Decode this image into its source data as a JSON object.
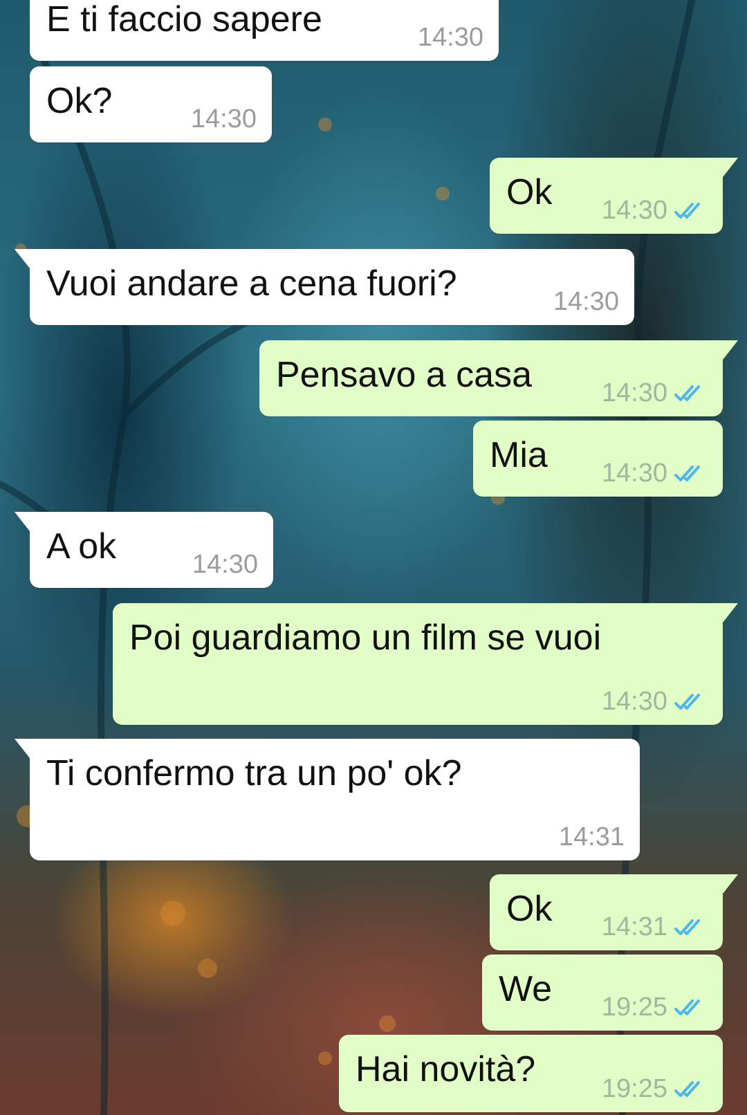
{
  "messages": [
    {
      "dir": "in",
      "text": "E ti faccio sapere",
      "time": "14:30"
    },
    {
      "dir": "in",
      "text": "Ok?",
      "time": "14:30"
    },
    {
      "dir": "out",
      "text": "Ok",
      "time": "14:30",
      "status": "read-double-check-icon"
    },
    {
      "dir": "in",
      "text": "Vuoi andare a cena fuori?",
      "time": "14:30"
    },
    {
      "dir": "out",
      "text": "Pensavo a casa",
      "time": "14:30",
      "status": "read-double-check-icon"
    },
    {
      "dir": "out",
      "text": "Mia",
      "time": "14:30",
      "status": "read-double-check-icon"
    },
    {
      "dir": "in",
      "text": "A ok",
      "time": "14:30"
    },
    {
      "dir": "out",
      "text": "Poi guardiamo un film se vuoi",
      "time": "14:30",
      "status": "read-double-check-icon"
    },
    {
      "dir": "in",
      "text": "Ti confermo tra un po' ok?",
      "time": "14:31"
    },
    {
      "dir": "out",
      "text": "Ok",
      "time": "14:31",
      "status": "read-double-check-icon"
    },
    {
      "dir": "out",
      "text": "We",
      "time": "19:25",
      "status": "read-double-check-icon"
    },
    {
      "dir": "out",
      "text": "Hai novità?",
      "time": "19:25",
      "status": "read-double-check-icon"
    }
  ],
  "colors": {
    "incoming_bubble": "#ffffff",
    "outgoing_bubble": "#e1fec6",
    "read_tick": "#4fb6ec",
    "timestamp": "#9b9b9b"
  }
}
